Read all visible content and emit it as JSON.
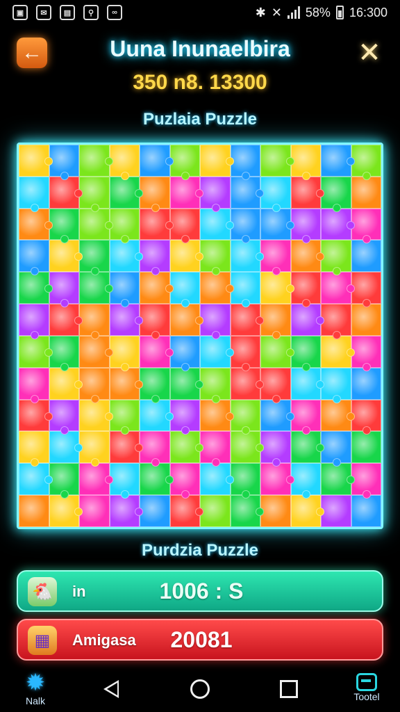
{
  "status_bar": {
    "left_icons": [
      "image-icon",
      "notification-icon",
      "sim-icon",
      "location-icon",
      "link-icon"
    ],
    "battery": "58%",
    "time": "16:300"
  },
  "header": {
    "title": "Uuna Inunaelbira",
    "score": "350 n8. 13300",
    "back_icon": "arrow-left-icon",
    "close_icon": "close-icon"
  },
  "puzzle": {
    "label_top": "Puzlaia Puzzle",
    "label_bottom": "Purdzia Puzzle",
    "rows": 12,
    "cols": 12,
    "palette": [
      "#ffd21f",
      "#18d64a",
      "#ff3b3b",
      "#1f9cff",
      "#ff2fb8",
      "#ff8a14",
      "#7be61c",
      "#22d8ff",
      "#b43cff"
    ]
  },
  "timer_bar": {
    "label": "in",
    "value": "1006 : S",
    "icon": "chicken-icon",
    "color": "#1cc99a"
  },
  "moves_bar": {
    "label": "Amigasa",
    "value": "20081",
    "icon": "shop-icon",
    "color": "#e42222"
  },
  "nav": {
    "gear_label": "Nalk",
    "tool_label": "Tootel"
  }
}
